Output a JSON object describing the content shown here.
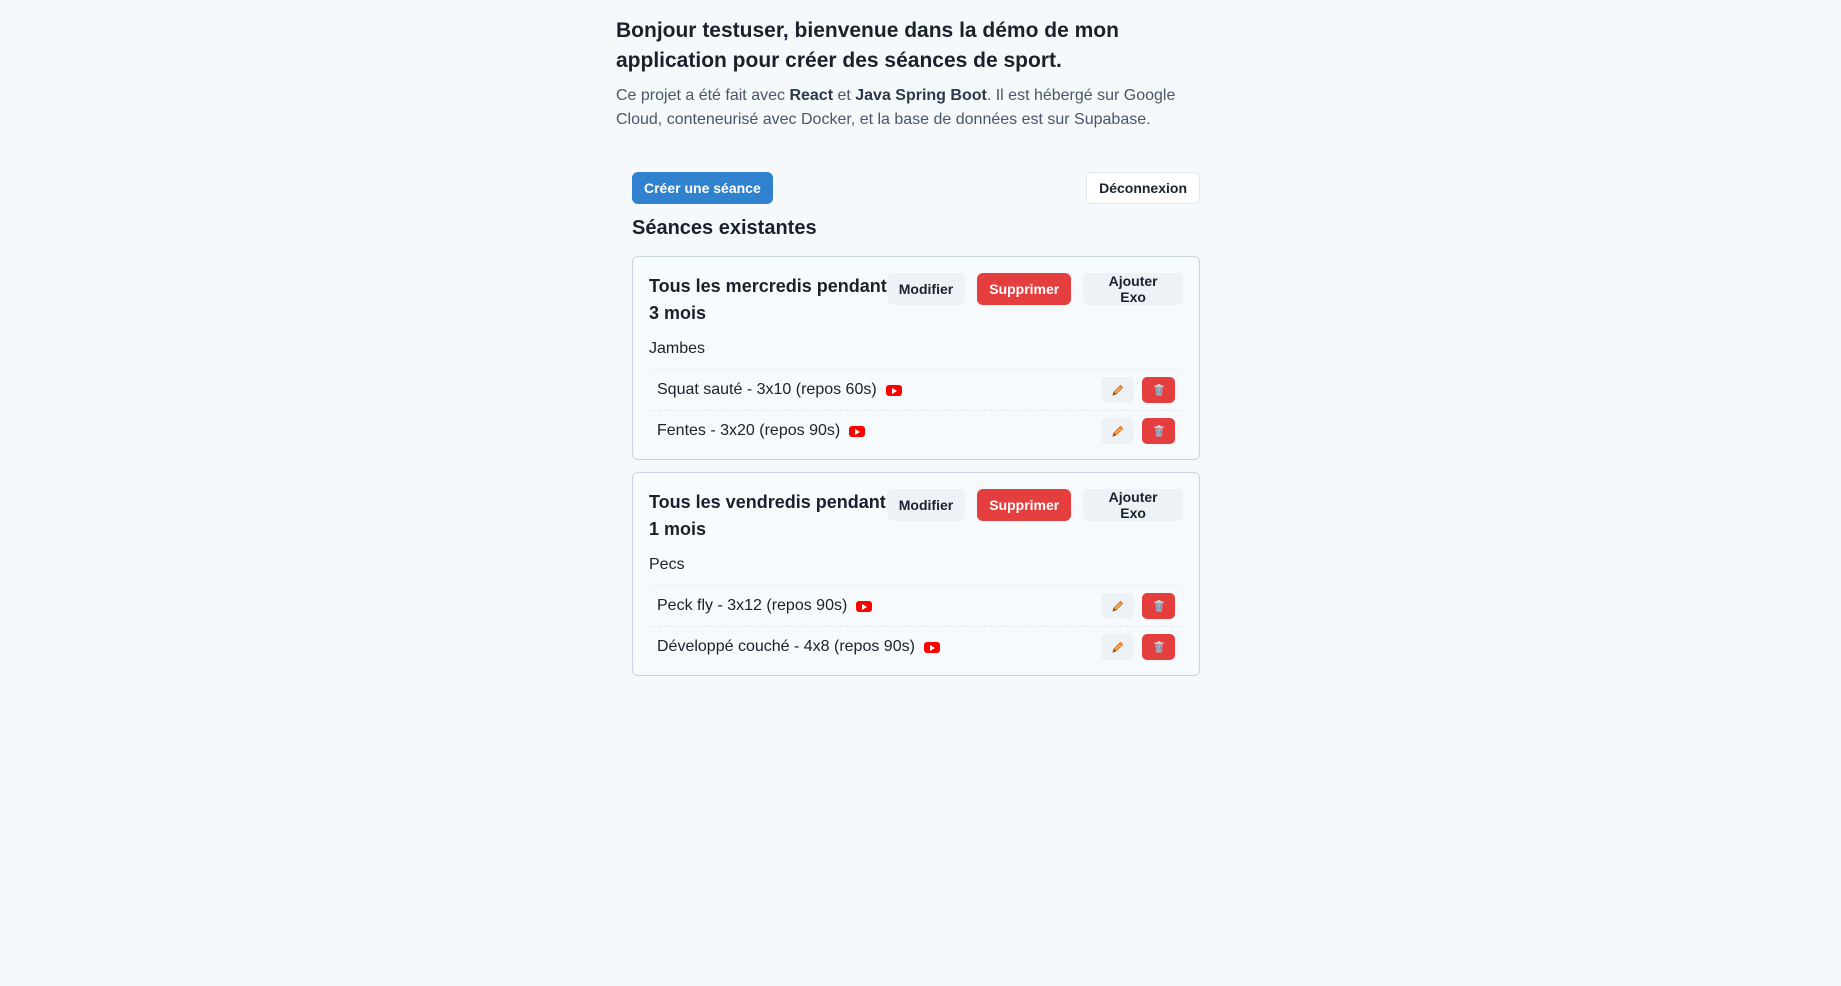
{
  "intro": {
    "title": "Bonjour testuser, bienvenue dans la démo de mon application pour créer des séances de sport.",
    "desc_part1": "Ce projet a été fait avec ",
    "desc_react": "React",
    "desc_part2": " et ",
    "desc_spring": "Java Spring Boot",
    "desc_part3": ". Il est hébergé sur Google Cloud, conteneurisé avec Docker, et la base de données est sur Supabase."
  },
  "toolbar": {
    "create_label": "Créer une séance",
    "logout_label": "Déconnexion"
  },
  "section_title": "Séances existantes",
  "seance_buttons": {
    "edit": "Modifier",
    "delete": "Supprimer",
    "add_exo": "Ajouter Exo"
  },
  "seances": [
    {
      "title": "Tous les mercredis pendant 3 mois",
      "muscle": "Jambes",
      "exercises": [
        {
          "label": "Squat sauté - 3x10 (repos 60s)"
        },
        {
          "label": "Fentes - 3x20 (repos 90s)"
        }
      ]
    },
    {
      "title": "Tous les vendredis pendant 1 mois",
      "muscle": "Pecs",
      "exercises": [
        {
          "label": "Peck fly - 3x12 (repos 90s)"
        },
        {
          "label": "Développé couché - 4x8 (repos 90s)"
        }
      ]
    }
  ],
  "icons": {
    "video": "youtube-icon",
    "edit": "pencil-icon",
    "delete": "trash-icon"
  },
  "colors": {
    "primary": "#3182ce",
    "danger": "#e53e3e",
    "background": "#f5f9fc"
  }
}
